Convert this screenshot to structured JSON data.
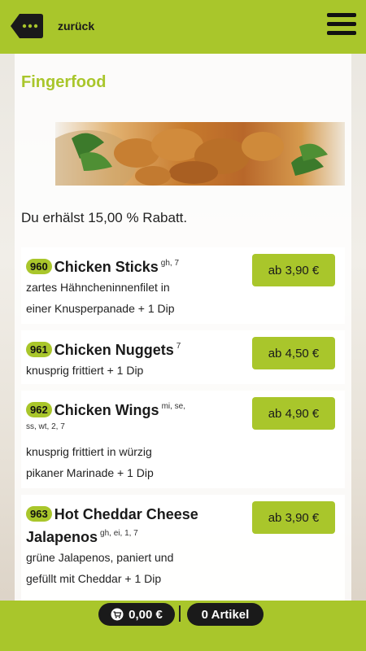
{
  "header": {
    "back_label": "zurück",
    "back_icon": "back-tag-icon",
    "menu_icon": "hamburger-icon"
  },
  "section": {
    "title": "Fingerfood",
    "discount_text": "Du erhälst 15,00 % Rabatt."
  },
  "items": [
    {
      "number": "960",
      "name": "Chicken Sticks",
      "allergens": "gh, 7",
      "desc_lines": [
        "zartes Hähncheninnenfilet in",
        "einer Knusperpanade + 1 Dip"
      ],
      "price": "ab 3,90 €"
    },
    {
      "number": "961",
      "name": "Chicken Nuggets",
      "allergens": "7",
      "desc_lines": [
        "knusprig frittiert + 1 Dip"
      ],
      "price": "ab 4,50 €"
    },
    {
      "number": "962",
      "name": "Chicken Wings",
      "allergens": "mi, se,",
      "allergens_2": "ss, wt, 2, 7",
      "desc_lines": [
        "knusprig frittiert in würzig",
        "pikaner Marinade + 1 Dip"
      ],
      "price": "ab 4,90 €"
    },
    {
      "number": "963",
      "name": "Hot Cheddar Cheese",
      "name_2": "Jalapenos",
      "allergens": "gh, ei, 1, 7",
      "desc_lines": [
        "grüne Jalapenos, paniert und",
        "gefüllt mit Cheddar + 1 Dip"
      ],
      "price": "ab 3,90 €"
    }
  ],
  "footer": {
    "cart_total": "0,00 €",
    "cart_icon": "cart-icon",
    "separator": "|",
    "articles": "0 Artikel"
  },
  "colors": {
    "accent": "#a9c62b",
    "dark": "#1a1a1a"
  }
}
